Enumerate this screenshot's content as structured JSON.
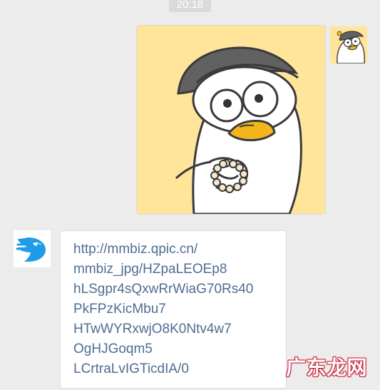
{
  "chat": {
    "timestamp": "20:18",
    "messages": [
      {
        "side": "right",
        "type": "sticker",
        "sticker_name": "duck-sticker"
      },
      {
        "side": "left",
        "type": "text",
        "text_lines": [
          "http://mmbiz.qpic.cn/",
          "mmbiz_jpg/HZpaLEOEp8",
          "hLSgpr4sQxwRrWiaG70Rs40",
          "PkFPzKicMbu7",
          "HTwWYRxwjO8K0Ntv4w7",
          "OgHJGoqm5",
          "LCrtraLvIGTicdIA/0"
        ]
      }
    ]
  },
  "watermark": {
    "text": "广东龙网"
  },
  "colors": {
    "chat_background": "#ececec",
    "link_text": "#4f6d92",
    "sticker_background": "#ffe59a",
    "logo_blue": "#1e9be9",
    "watermark_outline": "#c91f37"
  },
  "icons": {
    "right_avatar": "duck-avatar",
    "left_avatar": "blue-logo-avatar"
  }
}
